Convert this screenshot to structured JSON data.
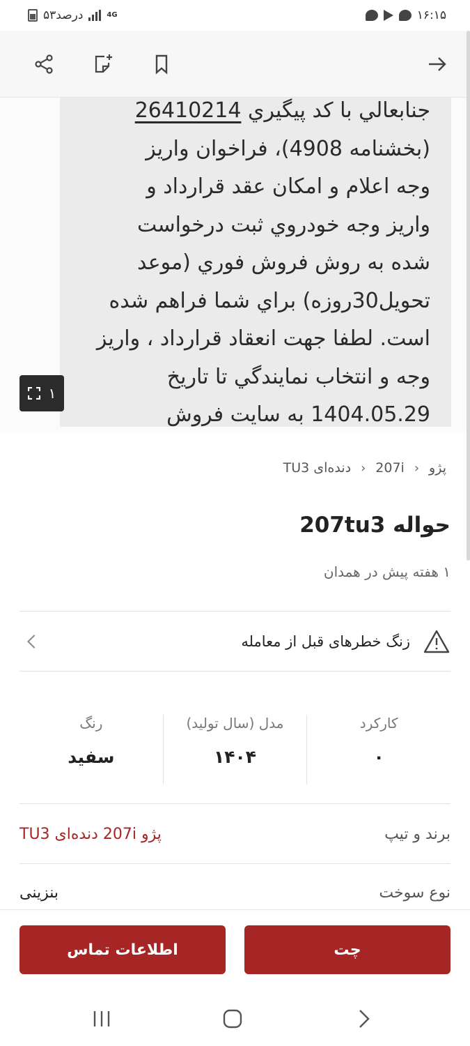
{
  "status_bar": {
    "time": "۱۶:۱۵",
    "network": "4G",
    "battery_text": "۵۳درصد"
  },
  "image": {
    "counter": "۱",
    "lines": [
      "جنابعالي با کد پيگيري",
      "26410214",
      "(بخشنامه 4908)، فراخوان واريز",
      "وجه اعلام و امکان عقد قرارداد و",
      "واريز وجه خودروي ثبت درخواست",
      "شده به روش فروش فوري (موعد",
      "تحويل30روزه) براي شما فراهم شده",
      "است. لطفا جهت انعقاد قرارداد ، واريز",
      "وجه و انتخاب نمايندگي تا تاريخ",
      "1404.05.29 به سايت فروش"
    ]
  },
  "breadcrumb": [
    "پژو",
    "207i",
    "دنده‌ای TU3"
  ],
  "title": "حواله 207tu3",
  "subtitle": "۱ هفته پیش در همدان",
  "risk_notice": "زنگ خطرهای قبل از معامله",
  "specs": [
    {
      "label": "کارکرد",
      "value": "۰"
    },
    {
      "label": "مدل (سال تولید)",
      "value": "۱۴۰۴"
    },
    {
      "label": "رنگ",
      "value": "سفید"
    }
  ],
  "details": [
    {
      "label": "برند و تیپ",
      "value": "پژو 207i دنده‌ای TU3"
    },
    {
      "label": "نوع سوخت",
      "value": "بنزینی"
    }
  ],
  "actions": {
    "chat": "چت",
    "contact": "اطلاعات تماس"
  },
  "colors": {
    "accent": "#a62626"
  }
}
